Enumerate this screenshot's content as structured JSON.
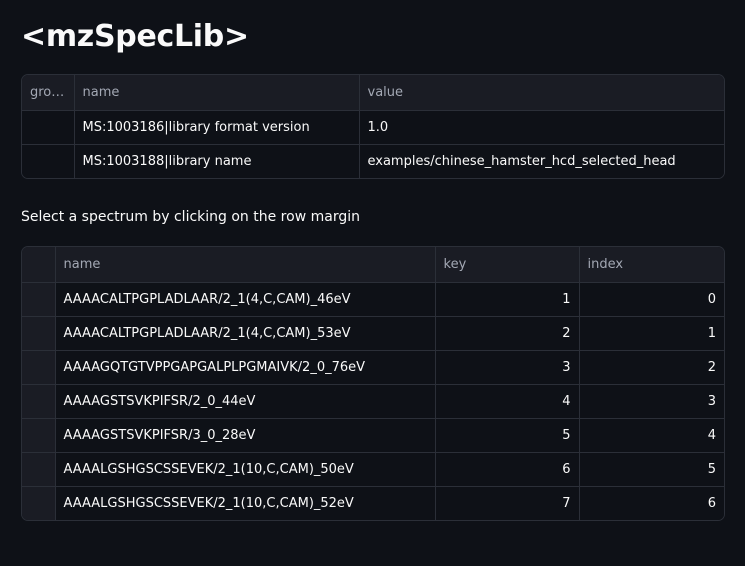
{
  "header": {
    "title": "<mzSpecLib>"
  },
  "metadata_table": {
    "columns": [
      "group",
      "name",
      "value"
    ],
    "rows": [
      {
        "group": "",
        "name": "MS:1003186|library format version",
        "value": "1.0"
      },
      {
        "group": "",
        "name": "MS:1003188|library name",
        "value": "examples/chinese_hamster_hcd_selected_head"
      }
    ]
  },
  "spectrum_section": {
    "caption": "Select a spectrum by clicking on the row margin"
  },
  "spectrum_table": {
    "columns": [
      "name",
      "key",
      "index"
    ],
    "rows": [
      {
        "name": "AAAACALTPGPLADLAAR/2_1(4,C,CAM)_46eV",
        "key": "1",
        "index": "0"
      },
      {
        "name": "AAAACALTPGPLADLAAR/2_1(4,C,CAM)_53eV",
        "key": "2",
        "index": "1"
      },
      {
        "name": "AAAAGQTGTVPPGAPGALPLPGMAIVK/2_0_76eV",
        "key": "3",
        "index": "2"
      },
      {
        "name": "AAAAGSTSVKPIFSR/2_0_44eV",
        "key": "4",
        "index": "3"
      },
      {
        "name": "AAAAGSTSVKPIFSR/3_0_28eV",
        "key": "5",
        "index": "4"
      },
      {
        "name": "AAAALGSHGSCSSEVEK/2_1(10,C,CAM)_50eV",
        "key": "6",
        "index": "5"
      },
      {
        "name": "AAAALGSHGSCSSEVEK/2_1(10,C,CAM)_52eV",
        "key": "7",
        "index": "6"
      }
    ]
  },
  "colors": {
    "background": "#0e1117",
    "header_bg": "#1a1c24",
    "border": "#2b2f38",
    "text": "#fafafa",
    "header_text": "#a3a8b4"
  }
}
